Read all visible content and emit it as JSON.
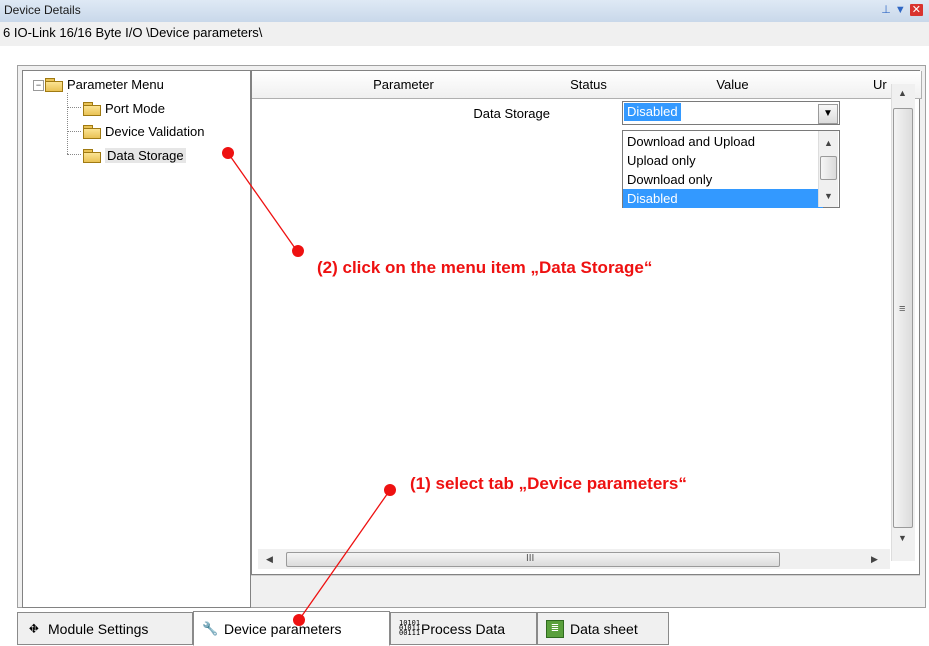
{
  "window": {
    "title": "Device Details",
    "path": "6 IO-Link 16/16 Byte I/O \\Device parameters\\"
  },
  "tree": {
    "root": "Parameter Menu",
    "items": [
      "Port Mode",
      "Device Validation",
      "Data Storage"
    ],
    "selected": "Data Storage"
  },
  "grid": {
    "columns": [
      "Parameter",
      "Status",
      "Value",
      "Ur"
    ],
    "rows": [
      {
        "parameter": "Data Storage",
        "status": "",
        "value": "Disabled"
      }
    ],
    "hscroll_grip": "III",
    "vscroll_grip": "≡"
  },
  "dropdown": {
    "selected": "Disabled",
    "options": [
      "Download and Upload",
      "Upload only",
      "Download only",
      "Disabled"
    ]
  },
  "tabs": [
    {
      "label": "Module Settings",
      "icon": "module-settings-icon",
      "active": false
    },
    {
      "label": "Device parameters",
      "icon": "wrench-icon",
      "active": true
    },
    {
      "label": "Process Data",
      "icon": "binary-data-icon",
      "active": false
    },
    {
      "label": "Data sheet",
      "icon": "datasheet-icon",
      "active": false
    }
  ],
  "annotations": {
    "step1": "(1)  select tab „Device parameters“",
    "step2": "(2) click on the menu item „Data Storage“",
    "color": "#ee1111"
  }
}
